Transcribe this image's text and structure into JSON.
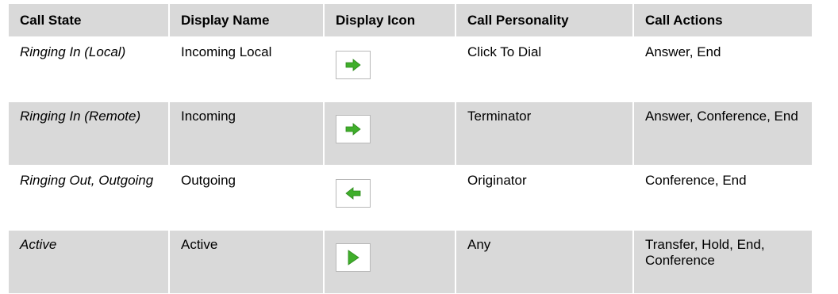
{
  "table": {
    "headers": [
      "Call State",
      "Display Name",
      "Display Icon",
      "Call Personality",
      "Call Actions"
    ],
    "rows": [
      {
        "call_state": "Ringing In (Local)",
        "display_name": "Incoming Local",
        "icon": "arrow-right-icon",
        "call_personality": "Click To Dial",
        "call_actions": "Answer, End"
      },
      {
        "call_state": "Ringing In (Remote)",
        "display_name": "Incoming",
        "icon": "arrow-right-icon",
        "call_personality": "Terminator",
        "call_actions": "Answer, Conference, End"
      },
      {
        "call_state": "Ringing Out, Outgoing",
        "display_name": "Outgoing",
        "icon": "arrow-left-icon",
        "call_personality": "Originator",
        "call_actions": "Conference, End"
      },
      {
        "call_state": "Active",
        "display_name": "Active",
        "icon": "play-icon",
        "call_personality": "Any",
        "call_actions": "Transfer, Hold, End, Conference"
      }
    ]
  },
  "colors": {
    "header_bg": "#d9d9d9",
    "alt_row_bg": "#d9d9d9",
    "icon_green": "#3fae2a"
  }
}
